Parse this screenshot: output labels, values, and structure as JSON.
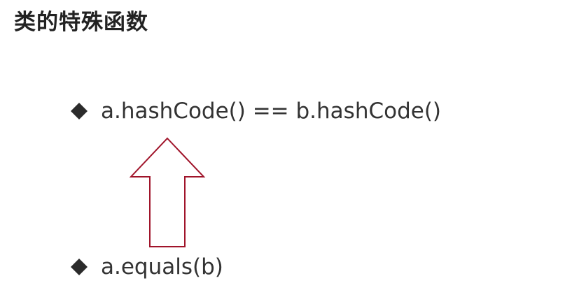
{
  "slide": {
    "title": "类的特殊函数",
    "bullets": [
      {
        "text": "a.hashCode() == b.hashCode()",
        "icon": "diamond-bullet-icon"
      },
      {
        "text": "a.equals(b)",
        "icon": "diamond-bullet-icon"
      }
    ],
    "arrow": {
      "icon": "up-arrow-outline-icon",
      "stroke_color": "#a0142a"
    },
    "colors": {
      "background": "#ffffff",
      "text": "#333333",
      "bullet": "#2b2b2b",
      "arrow": "#a0142a"
    }
  }
}
